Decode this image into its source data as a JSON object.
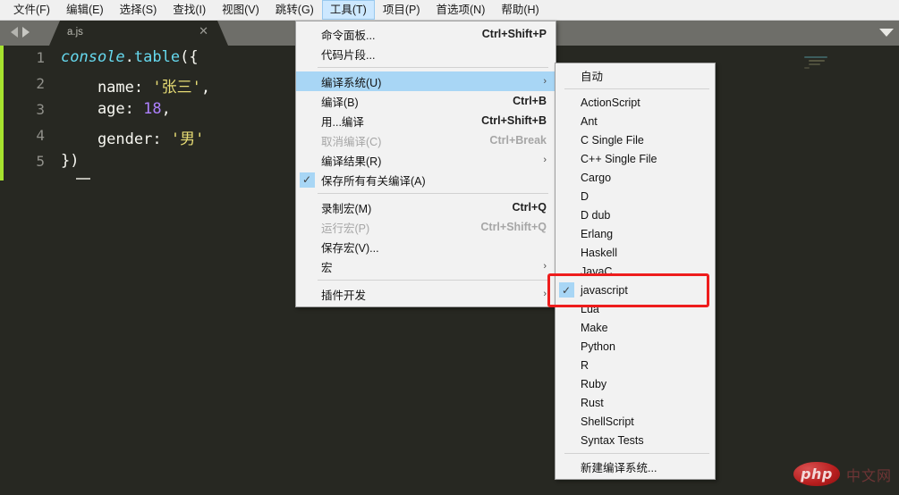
{
  "menubar": {
    "items": [
      {
        "label": "文件(F)",
        "active": false
      },
      {
        "label": "编辑(E)",
        "active": false
      },
      {
        "label": "选择(S)",
        "active": false
      },
      {
        "label": "查找(I)",
        "active": false
      },
      {
        "label": "视图(V)",
        "active": false
      },
      {
        "label": "跳转(G)",
        "active": false
      },
      {
        "label": "工具(T)",
        "active": true
      },
      {
        "label": "项目(P)",
        "active": false
      },
      {
        "label": "首选项(N)",
        "active": false
      },
      {
        "label": "帮助(H)",
        "active": false
      }
    ]
  },
  "tabs": {
    "prev_icon": "arrow-left-icon",
    "next_icon": "arrow-right-icon",
    "active": {
      "label": "a.js",
      "close_icon": "close-icon"
    }
  },
  "editor": {
    "gutter": [
      "1",
      "2",
      "3",
      "4",
      "5"
    ],
    "active_line": 5,
    "lines": [
      {
        "n": "1",
        "tokens": [
          {
            "t": "console",
            "c": "tok-const"
          },
          {
            "t": ".",
            "c": "tok-punc"
          },
          {
            "t": "table",
            "c": "tok-fn"
          },
          {
            "t": "({",
            "c": "tok-punc"
          }
        ]
      },
      {
        "n": "2",
        "tokens": [
          {
            "t": "    name: ",
            "c": "tok-prop"
          },
          {
            "t": "'张三'",
            "c": "tok-string"
          },
          {
            "t": ",",
            "c": "tok-punc"
          }
        ]
      },
      {
        "n": "3",
        "tokens": [
          {
            "t": "    age: ",
            "c": "tok-prop"
          },
          {
            "t": "18",
            "c": "tok-number"
          },
          {
            "t": ",",
            "c": "tok-punc"
          }
        ]
      },
      {
        "n": "4",
        "tokens": [
          {
            "t": "    gender: ",
            "c": "tok-prop"
          },
          {
            "t": "'男'",
            "c": "tok-string"
          }
        ]
      },
      {
        "n": "5",
        "tokens": [
          {
            "t": "})",
            "c": "tok-punc"
          }
        ]
      }
    ]
  },
  "tools_menu": {
    "items": [
      {
        "type": "item",
        "label": "命令面板...",
        "accel": "Ctrl+Shift+P"
      },
      {
        "type": "item",
        "label": "代码片段...",
        "accel": ""
      },
      {
        "type": "sep"
      },
      {
        "type": "item",
        "label": "编译系统(U)",
        "accel": "",
        "arrow": "›",
        "highlight": true
      },
      {
        "type": "item",
        "label": "编译(B)",
        "accel": "Ctrl+B"
      },
      {
        "type": "item",
        "label": "用...编译",
        "accel": "Ctrl+Shift+B"
      },
      {
        "type": "item",
        "label": "取消编译(C)",
        "accel": "Ctrl+Break",
        "disabled": true
      },
      {
        "type": "item",
        "label": "编译结果(R)",
        "accel": "",
        "arrow": "›"
      },
      {
        "type": "item",
        "label": "保存所有有关编译(A)",
        "accel": "",
        "checked": true
      },
      {
        "type": "sep"
      },
      {
        "type": "item",
        "label": "录制宏(M)",
        "accel": "Ctrl+Q"
      },
      {
        "type": "item",
        "label": "运行宏(P)",
        "accel": "Ctrl+Shift+Q",
        "disabled": true
      },
      {
        "type": "item",
        "label": "保存宏(V)...",
        "accel": ""
      },
      {
        "type": "item",
        "label": "宏",
        "accel": "",
        "arrow": "›"
      },
      {
        "type": "sep"
      },
      {
        "type": "item",
        "label": "插件开发",
        "accel": "",
        "arrow": "›"
      }
    ]
  },
  "build_system_menu": {
    "items": [
      {
        "type": "item",
        "label": "自动"
      },
      {
        "type": "sep"
      },
      {
        "type": "item",
        "label": "ActionScript"
      },
      {
        "type": "item",
        "label": "Ant"
      },
      {
        "type": "item",
        "label": "C Single File"
      },
      {
        "type": "item",
        "label": "C++ Single File"
      },
      {
        "type": "item",
        "label": "Cargo"
      },
      {
        "type": "item",
        "label": "D"
      },
      {
        "type": "item",
        "label": "D dub"
      },
      {
        "type": "item",
        "label": "Erlang"
      },
      {
        "type": "item",
        "label": "Haskell"
      },
      {
        "type": "item",
        "label": "JavaC"
      },
      {
        "type": "item",
        "label": "javascript",
        "checked": true
      },
      {
        "type": "item",
        "label": "Lua"
      },
      {
        "type": "item",
        "label": "Make"
      },
      {
        "type": "item",
        "label": "Python"
      },
      {
        "type": "item",
        "label": "R"
      },
      {
        "type": "item",
        "label": "Ruby"
      },
      {
        "type": "item",
        "label": "Rust"
      },
      {
        "type": "item",
        "label": "ShellScript"
      },
      {
        "type": "item",
        "label": "Syntax Tests"
      },
      {
        "type": "sep"
      },
      {
        "type": "item",
        "label": "新建编译系统..."
      }
    ]
  },
  "annotation": {
    "shape": "red-rectangle",
    "target": "javascript",
    "color": "#ee1d1d"
  },
  "watermark": {
    "logo_text": "php",
    "text": "中文网"
  },
  "colors": {
    "editor_bg": "#272822",
    "menu_bg": "#f2f2f2",
    "highlight": "#a8d6f5",
    "accent_green": "#a6e22e",
    "string": "#e6db74",
    "number": "#ae81ff",
    "keyword": "#66d9ef"
  }
}
